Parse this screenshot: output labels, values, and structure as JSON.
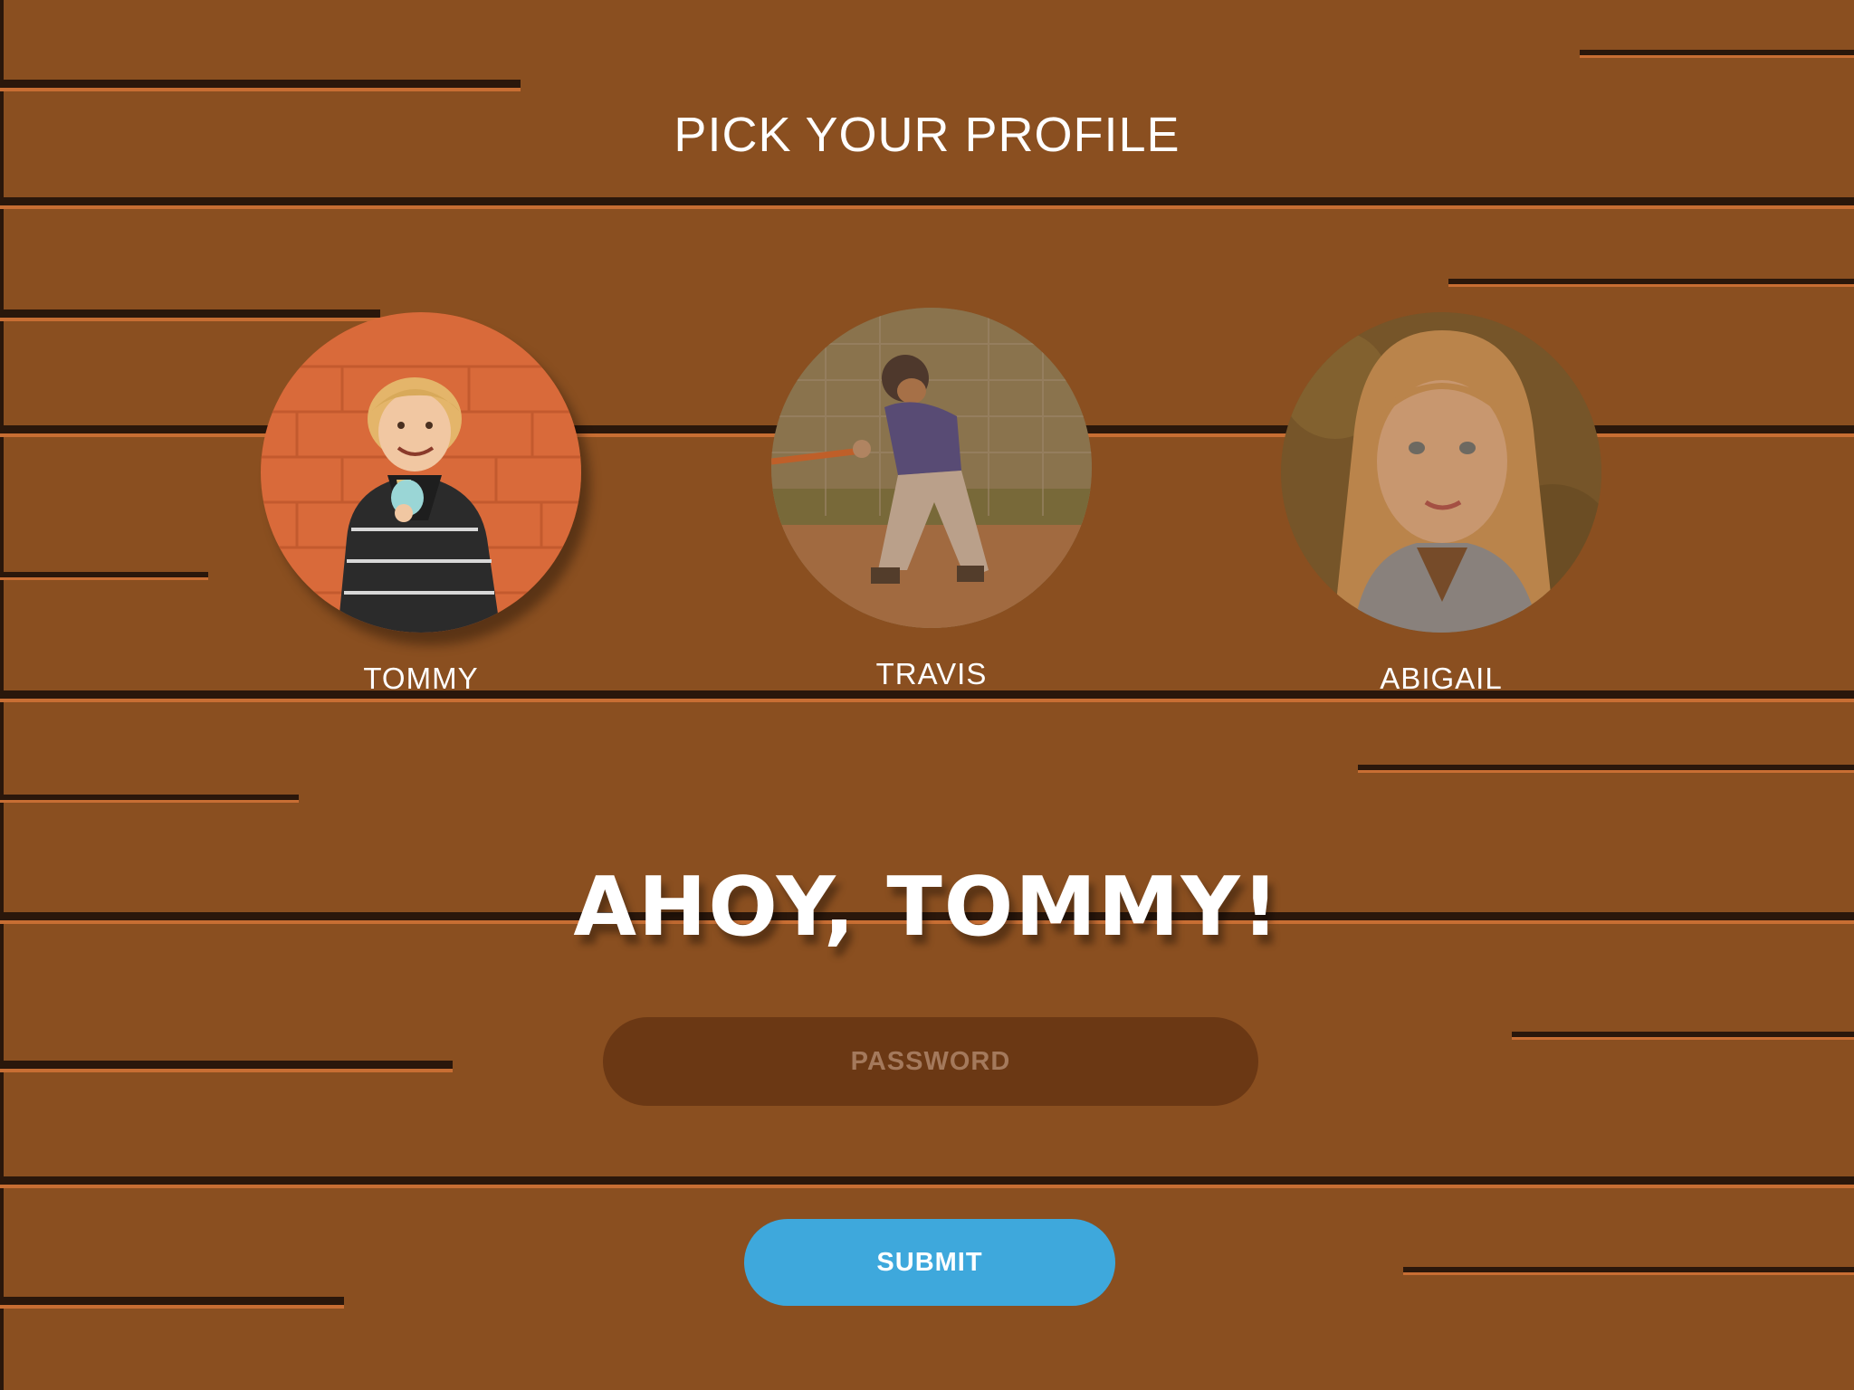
{
  "header": {
    "title": "PICK YOUR PROFILE"
  },
  "profiles": [
    {
      "name": "TOMMY",
      "selected": true,
      "photo": "boy-eating-ice-cream"
    },
    {
      "name": "TRAVIS",
      "selected": false,
      "photo": "boy-swinging-baseball-bat"
    },
    {
      "name": "ABIGAIL",
      "selected": false,
      "photo": "girl-portrait"
    }
  ],
  "greeting": "AHOY, TOMMY!",
  "password": {
    "placeholder": "PASSWORD",
    "value": ""
  },
  "submit": {
    "label": "SUBMIT"
  },
  "colors": {
    "wood": "#8a4f20",
    "wood_dark": "#2a170b",
    "wood_highlight": "#c86e33",
    "input_bg": "#6b3814",
    "accent": "#3ea8dc",
    "text": "#ffffff"
  }
}
